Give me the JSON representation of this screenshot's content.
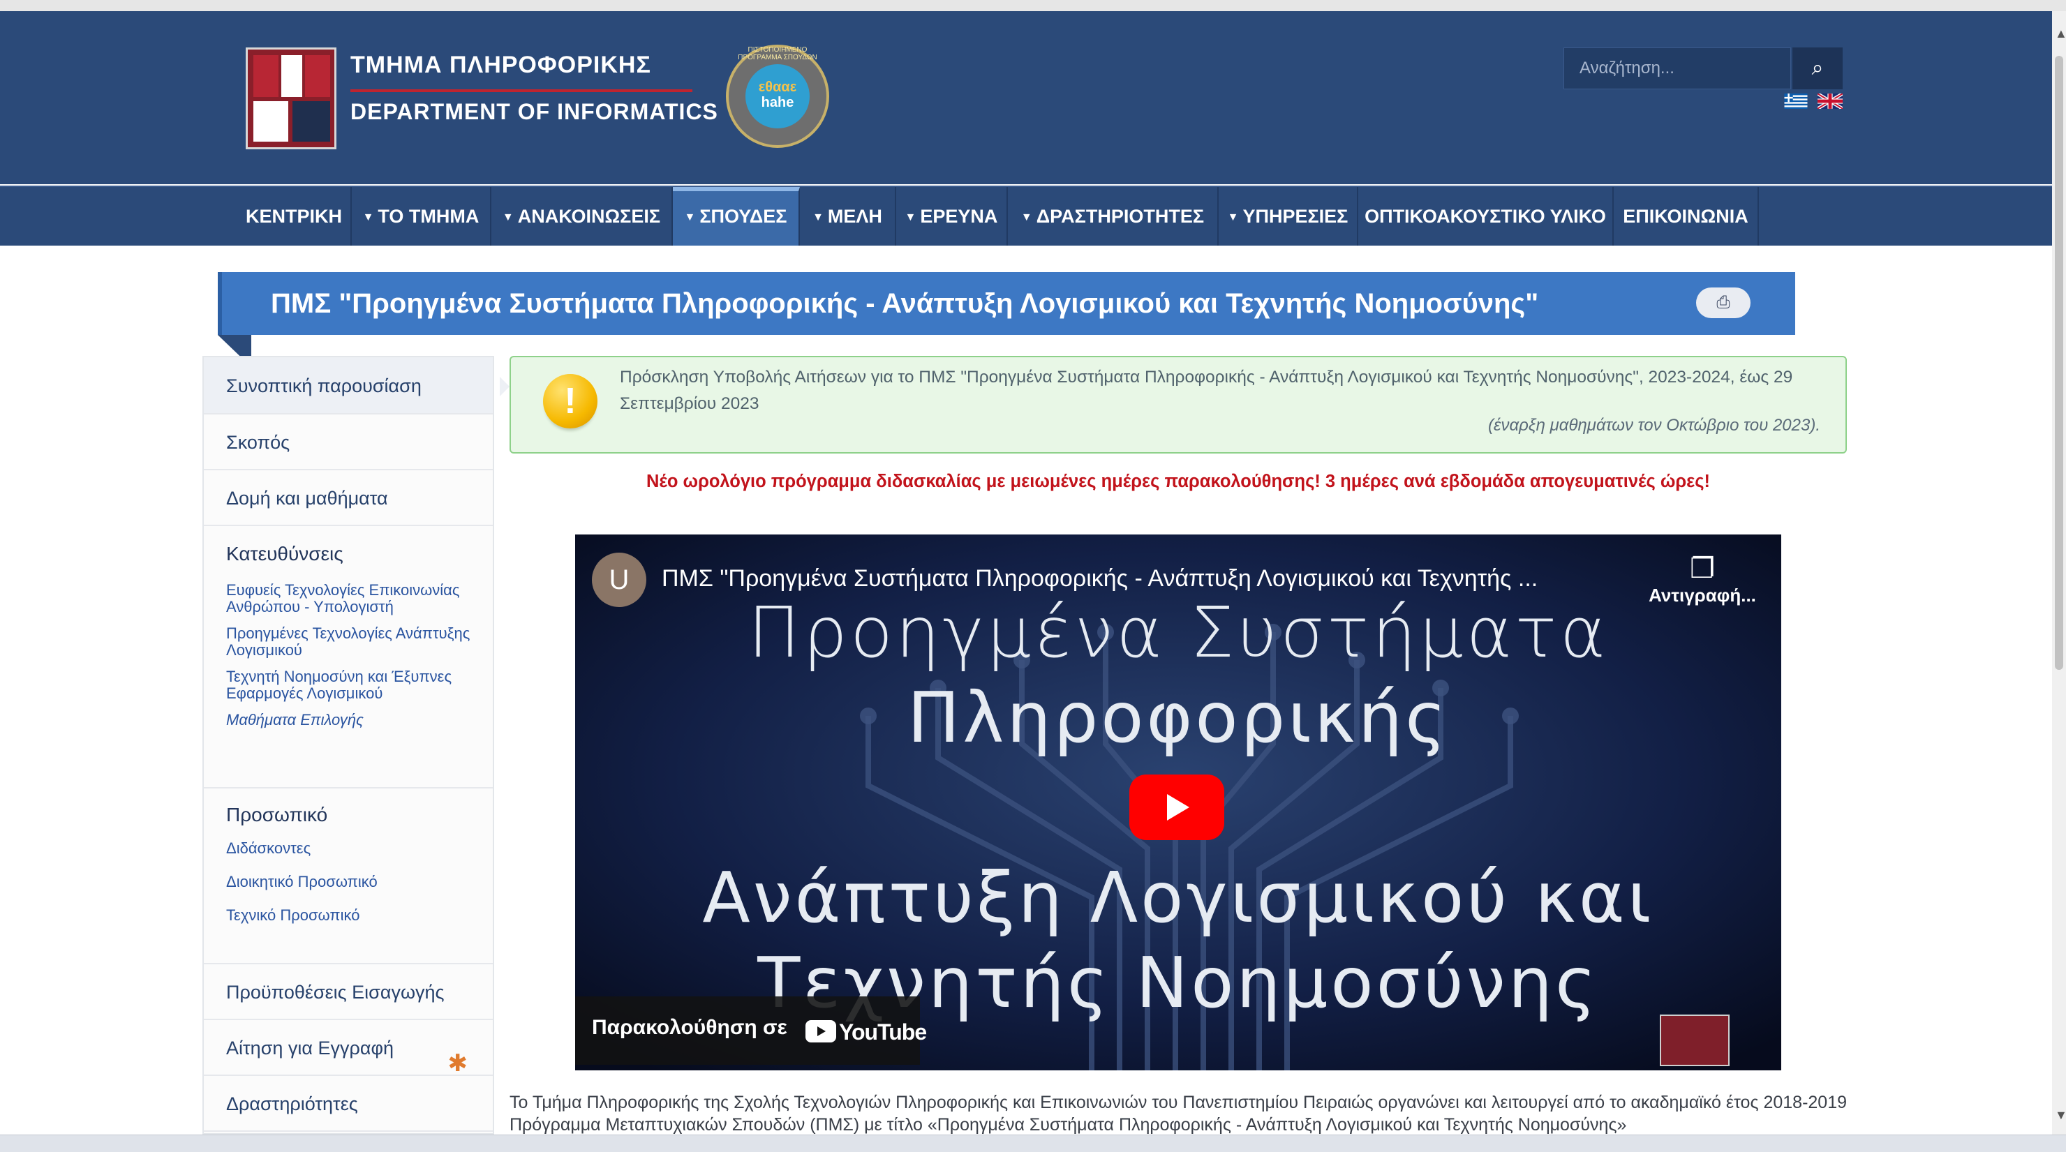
{
  "header": {
    "logo_text_greek": "ΤΜΗΜΑ ΠΛΗΡΟΦΟΡΙΚΗΣ",
    "logo_text_english": "DEPARTMENT OF INFORMATICS",
    "accreditation_badge": {
      "line1": "εθααε",
      "line2": "hahe",
      "ring_text": "ΠΙΣΤΟΠΟΙΗΜΕΝΟ ΠΡΟΓΡΑΜΜΑ ΣΠΟΥΔΩΝ"
    },
    "search": {
      "placeholder": "Αναζήτηση...",
      "button_icon": "search-icon"
    },
    "languages": [
      "greek-flag-icon",
      "uk-flag-icon"
    ]
  },
  "nav": {
    "items": [
      {
        "label": "ΚΕΝΤΡΙΚΗ",
        "has_dropdown": false
      },
      {
        "label": "ΤΟ ΤΜΗΜΑ",
        "has_dropdown": true
      },
      {
        "label": "ΑΝΑΚΟΙΝΩΣΕΙΣ",
        "has_dropdown": true
      },
      {
        "label": "ΣΠΟΥΔΕΣ",
        "has_dropdown": true,
        "active": true
      },
      {
        "label": "ΜΕΛΗ",
        "has_dropdown": true
      },
      {
        "label": "ΕΡΕΥΝΑ",
        "has_dropdown": true
      },
      {
        "label": "ΔΡΑΣΤΗΡΙΟΤΗΤΕΣ",
        "has_dropdown": true
      },
      {
        "label": "ΥΠΗΡΕΣΙΕΣ",
        "has_dropdown": true
      },
      {
        "label": "ΟΠΤΙΚΟΑΚΟΥΣΤΙΚΟ ΥΛΙΚΟ",
        "has_dropdown": false
      },
      {
        "label": "ΕΠΙΚΟΙΝΩΝΙΑ",
        "has_dropdown": false
      }
    ]
  },
  "page": {
    "title": "ΠΜΣ \"Προηγμένα Συστήματα Πληροφορικής - Ανάπτυξη Λογισμικού και Τεχνητής Νοημοσύνης\"",
    "print_icon": "printer-icon"
  },
  "sidebar": {
    "summary": "Συνοπτική παρουσίαση",
    "purpose": "Σκοπός",
    "structure": "Δομή και μαθήματα",
    "directions": {
      "heading": "Κατευθύνσεις",
      "links": [
        "Ευφυείς Τεχνολογίες Επικοινωνίας Ανθρώπου - Υπολογιστή",
        "Προηγμένες Τεχνολογίες Ανάπτυξης Λογισμικού",
        "Τεχνητή Νοημοσύνη και Έξυπνες Εφαρμογές Λογισμικού",
        "Μαθήματα Επιλογής"
      ]
    },
    "staff": {
      "heading": "Προσωπικό",
      "links": [
        "Διδάσκοντες",
        "Διοικητικό Προσωπικό",
        "Τεχνικό Προσωπικό"
      ]
    },
    "admission": "Προϋποθέσεις Εισαγωγής",
    "application": "Αίτηση για Εγγραφή",
    "activities": "Δραστηριότητες"
  },
  "alert": {
    "icon": "exclamation-icon",
    "text": "Πρόσκληση Υποβολής Αιτήσεων για το ΠΜΣ \"Προηγμένα Συστήματα Πληροφορικής - Ανάπτυξη Λογισμικού και Τεχνητής Νοημοσύνης\", 2023-2024, έως 29 Σεπτεμβρίου 2023",
    "note": "(έναρξη μαθημάτων τον Οκτώβριο του 2023)."
  },
  "notice": "Νέο ωρολόγιο πρόγραμμα διδασκαλίας με μειωμένες ημέρες παρακολούθησης! 3 ημέρες ανά εβδομάδα απογευματινές ώρες!",
  "video": {
    "channel_initial": "U",
    "title": "ΠΜΣ \"Προηγμένα Συστήματα Πληροφορικής - Ανάπτυξη Λογισμικού και Τεχνητής ...",
    "copy_label": "Αντιγραφή...",
    "line1": "Προηγμένα Συστήματα",
    "line2": "Πληροφορικής",
    "line3": "Ανάπτυξη Λογισμικού και",
    "line4": "Τεχνητής Νοημοσύνης",
    "watch_label": "Παρακολούθηση σε",
    "youtube_wordmark": "YouTube"
  },
  "body_text": "Το Τμήμα Πληροφορικής της Σχολής Τεχνολογιών Πληροφορικής και Επικοινωνιών του Πανεπιστημίου Πειραιώς οργανώνει και λειτουργεί από το ακαδημαϊκό έτος 2018-2019 Πρόγραμμα Μεταπτυχιακών Σπουδών (ΠΜΣ) με τίτλο «Προηγμένα Συστήματα Πληροφορικής - Ανάπτυξη Λογισμικού και Τεχνητής Νοημοσύνης»",
  "colors": {
    "header_bg": "#2b4a79",
    "nav_active": "#3b6aa8",
    "title_banner": "#3d78c4",
    "alert_bg": "#e8f7e6",
    "notice_red": "#c2131b",
    "youtube_red": "#ff0000"
  }
}
